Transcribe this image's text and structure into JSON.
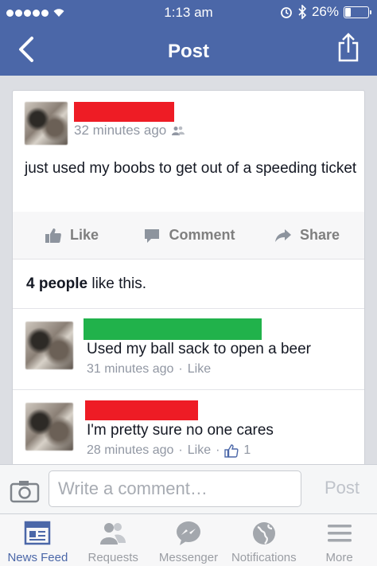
{
  "status_bar": {
    "time": "1:13 am",
    "battery": "26%",
    "battery_level": 0.26
  },
  "nav": {
    "title": "Post"
  },
  "post": {
    "timestamp": "32 minutes ago",
    "text": "just used my boobs to get out of a speeding ticket"
  },
  "actions": {
    "like": "Like",
    "comment": "Comment",
    "share": "Share"
  },
  "likes": {
    "count_text": "4 people",
    "suffix": "like this."
  },
  "comments": [
    {
      "text": "Used my ball sack to open a beer",
      "time": "31 minutes ago",
      "like_label": "Like"
    },
    {
      "text": "I'm pretty sure no one cares",
      "time": "28 minutes ago",
      "like_label": "Like",
      "like_count": "1"
    }
  ],
  "compose": {
    "placeholder": "Write a comment…",
    "post_label": "Post"
  },
  "tabs": [
    {
      "label": "News Feed",
      "icon": "news-feed-icon",
      "active": true
    },
    {
      "label": "Requests",
      "icon": "requests-icon"
    },
    {
      "label": "Messenger",
      "icon": "messenger-icon"
    },
    {
      "label": "Notifications",
      "icon": "globe-icon"
    },
    {
      "label": "More",
      "icon": "menu-icon"
    }
  ],
  "colors": {
    "brand": "#4b67a8",
    "redaction_red": "#ee1c25",
    "redaction_green": "#21b24b"
  }
}
